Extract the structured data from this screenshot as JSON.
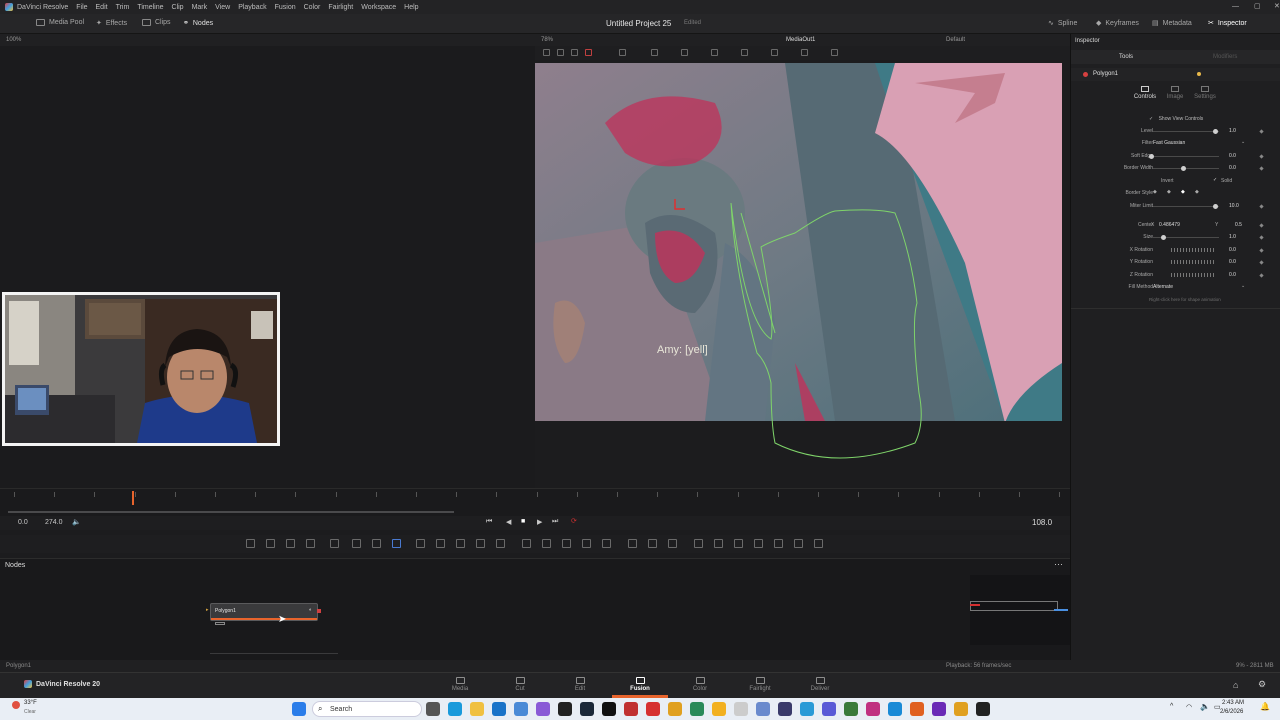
{
  "menu": [
    "DaVinci Resolve",
    "File",
    "Edit",
    "Trim",
    "Timeline",
    "Clip",
    "Mark",
    "View",
    "Playback",
    "Fusion",
    "Color",
    "Fairlight",
    "Workspace",
    "Help"
  ],
  "toolbar": {
    "zoom_left": "100%",
    "media_pool": "Media Pool",
    "effects": "Effects",
    "clips": "Clips",
    "nodes": "Nodes",
    "project_title": "Untitled Project 25",
    "project_status": "Edited",
    "spline": "Spline",
    "keyframes": "Keyframes",
    "metadata": "Metadata",
    "inspector": "Inspector"
  },
  "viewer": {
    "zoom": "78%",
    "name": "MediaOut1",
    "layout": "Default",
    "subtitle": "Amy: [yell]"
  },
  "inspector": {
    "title": "Inspector",
    "tools_tab": "Tools",
    "modifiers_tab": "Modifiers",
    "node_name": "Polygon1",
    "subtabs": [
      "Controls",
      "Image",
      "Settings"
    ],
    "show_view_controls": "Show View Controls",
    "rows": {
      "level": {
        "label": "Level",
        "value": "1.0"
      },
      "filter": {
        "label": "Filter",
        "value": "Fast Gaussian"
      },
      "soft_edge": {
        "label": "Soft Edge",
        "value": "0.0"
      },
      "border_width": {
        "label": "Border Width",
        "value": "0.0"
      },
      "invert": "Invert",
      "solid": "Solid",
      "border_style": {
        "label": "Border Style"
      },
      "miter_limit": {
        "label": "Miter Limit",
        "value": "10.0"
      },
      "center": {
        "label": "Center",
        "x_label": "X",
        "x": "0.486479",
        "y_label": "Y",
        "y": "0.5"
      },
      "size": {
        "label": "Size",
        "value": "1.0"
      },
      "x_rotation": {
        "label": "X Rotation",
        "value": "0.0"
      },
      "y_rotation": {
        "label": "Y Rotation",
        "value": "0.0"
      },
      "z_rotation": {
        "label": "Z Rotation",
        "value": "0.0"
      },
      "fill_method": {
        "label": "Fill Method",
        "value": "Alternate"
      }
    },
    "hint": "Right-click here for shape animation"
  },
  "transport": {
    "start": "0.0",
    "end": "274.0",
    "current": "108.0"
  },
  "nodes": {
    "title": "Nodes",
    "node_label": "Polygon1"
  },
  "status": {
    "left": "Polygon1",
    "playback": "Playback: 56 frames/sec",
    "memory": "9% - 2811 MB"
  },
  "pages": {
    "app": "DaVinci Resolve 20",
    "items": [
      "Media",
      "Cut",
      "Edit",
      "Fusion",
      "Color",
      "Fairlight",
      "Deliver"
    ],
    "active": "Fusion"
  },
  "taskbar": {
    "weather_temp": "33°F",
    "weather_desc": "Clear",
    "search": "Search",
    "time": "2:43 AM",
    "date": "2/6/2026"
  },
  "colors": {
    "accent": "#e8642c",
    "polygon": "#7fd46a",
    "node_bar": "#e8642c"
  }
}
